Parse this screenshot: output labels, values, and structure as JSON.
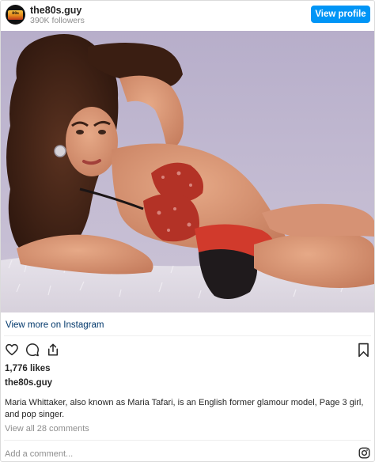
{
  "account": {
    "username": "the80s.guy",
    "followers": "390K followers",
    "avatar_logo_text": "the80s.guy"
  },
  "buttons": {
    "view_profile": "View profile"
  },
  "post": {
    "image_alt": "Maria Whittaker photo",
    "view_more": "View more on Instagram",
    "likes": "1,776 likes",
    "username": "the80s.guy",
    "caption": "Maria Whittaker, also known as Maria Tafari, is an English former glamour model, Page 3 girl, and pop singer.",
    "comments_link": "View all 28 comments",
    "comment_placeholder": "Add a comment..."
  },
  "icons": {
    "like": "heart-icon",
    "comment": "comment-icon",
    "share": "share-icon",
    "save": "bookmark-icon",
    "instagram": "instagram-icon"
  },
  "colors": {
    "brand_blue": "#0095f6",
    "link_blue": "#00376b",
    "secondary_text": "#8e8e8e",
    "text": "#262626"
  }
}
